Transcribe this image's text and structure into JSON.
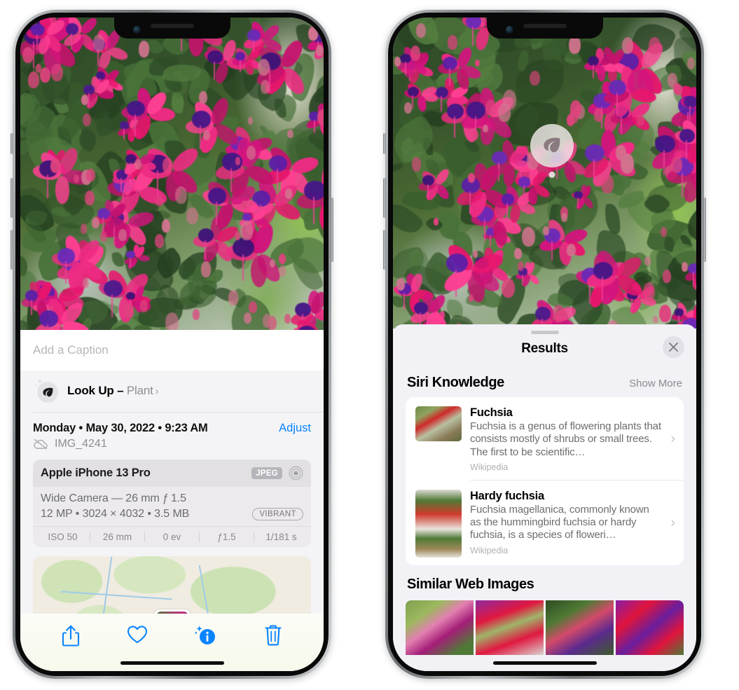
{
  "left_phone": {
    "caption_field": {
      "placeholder": "Add a Caption",
      "value": ""
    },
    "lookup": {
      "label": "Look Up – ",
      "subject": "Plant",
      "chevron": "›",
      "icon": "leaf-icon"
    },
    "metadata": {
      "date_line": "Monday • May 30, 2022 • 9:23 AM",
      "adjust_label": "Adjust",
      "file_name": "IMG_4241",
      "cloud_icon": "icloud-slash-icon"
    },
    "camera_card": {
      "device": "Apple iPhone 13 Pro",
      "format_badge": "JPEG",
      "lens_icon": "aperture-icon",
      "lens_line": "Wide Camera — 26 mm ƒ 1.5",
      "specs_line": "12 MP • 3024 × 4032 • 3.5 MB",
      "style_badge": "VIBRANT",
      "exif": [
        "ISO 50",
        "26 mm",
        "0 ev",
        "ƒ1.5",
        "1/181 s"
      ]
    },
    "toolbar": [
      {
        "name": "share-button",
        "icon": "share-icon"
      },
      {
        "name": "favorite-button",
        "icon": "heart-icon"
      },
      {
        "name": "info-button",
        "icon": "info-sparkle-icon"
      },
      {
        "name": "delete-button",
        "icon": "trash-icon"
      }
    ]
  },
  "right_phone": {
    "visual_lookup_badge": {
      "icon": "leaf-icon"
    },
    "sheet": {
      "title": "Results",
      "close_icon": "close-icon",
      "sections": [
        {
          "title": "Siri Knowledge",
          "action": "Show More",
          "cards": [
            {
              "name": "Fuchsia",
              "description": "Fuchsia is a genus of flowering plants that consists mostly of shrubs or small trees. The first to be scientific…",
              "source": "Wikipedia",
              "thumb": "fuchsia-red-flowers-thumb"
            },
            {
              "name": "Hardy fuchsia",
              "description": "Fuchsia magellanica, commonly known as the hummingbird fuchsia or hardy fuchsia, is a species of floweri…",
              "source": "Wikipedia",
              "thumb": "hardy-fuchsia-branch-thumb"
            }
          ]
        },
        {
          "title": "Similar Web Images",
          "images": [
            "fuchsia-pink-white-bloom",
            "fuchsia-red-closeup",
            "fuchsia-shrub-buds",
            "fuchsia-purple-magenta"
          ]
        }
      ]
    }
  },
  "colors": {
    "accent_blue": "#0a84ff",
    "sheet_bg": "#f2f1f6",
    "card_bg": "#ffffff",
    "muted_text": "#8e8e93"
  }
}
